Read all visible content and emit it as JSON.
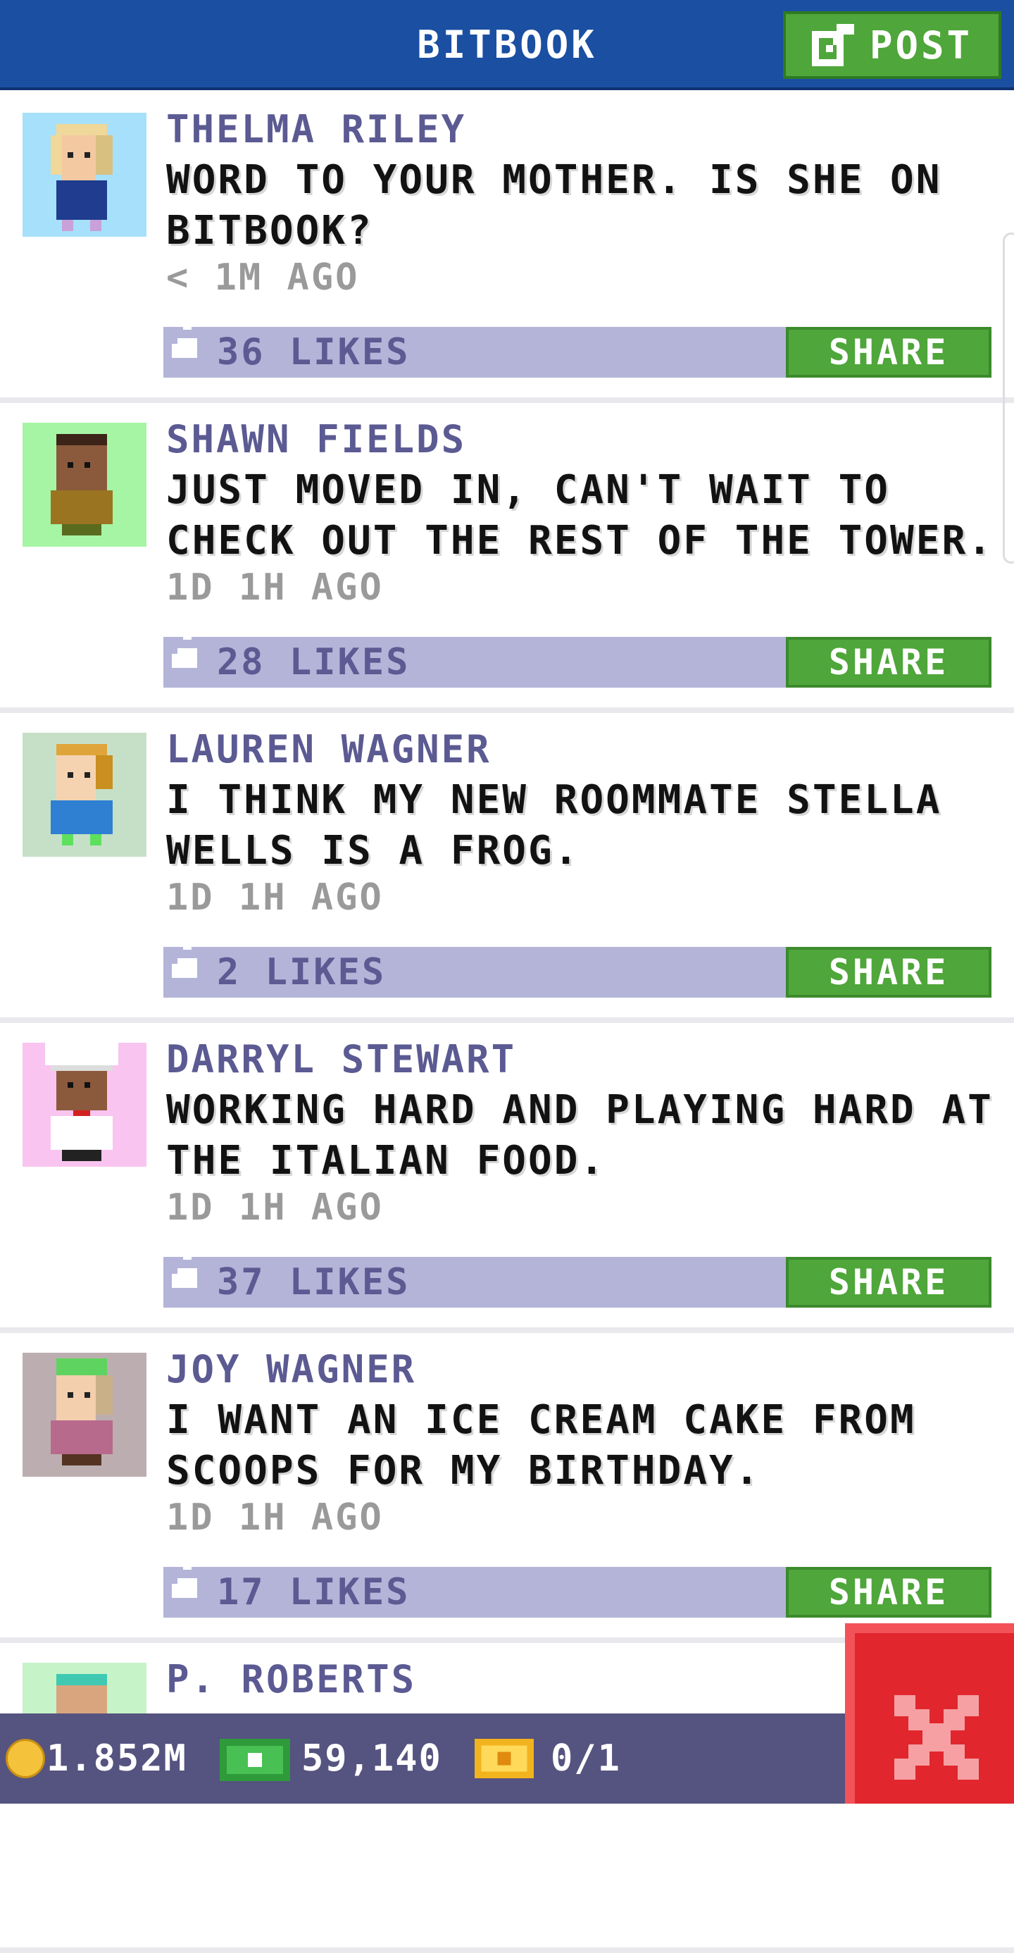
{
  "header": {
    "title": "BITBOOK",
    "post_label": "POST"
  },
  "posts": [
    {
      "name": "THELMA RILEY",
      "message": "WORD TO YOUR MOTHER. IS SHE ON BITBOOK?",
      "time": "< 1M AGO",
      "likes": "36 LIKES",
      "share": "SHARE",
      "avatar_bg": "#a6e0fb"
    },
    {
      "name": "SHAWN FIELDS",
      "message": "JUST MOVED IN, CAN'T WAIT TO CHECK OUT THE REST OF THE TOWER.",
      "time": "1D 1H AGO",
      "likes": "28 LIKES",
      "share": "SHARE",
      "avatar_bg": "#a5f5a5"
    },
    {
      "name": "LAUREN WAGNER",
      "message": "I THINK MY NEW ROOMMATE STELLA WELLS IS A FROG.",
      "time": "1D 1H AGO",
      "likes": "2 LIKES",
      "share": "SHARE",
      "avatar_bg": "#c6e0c8"
    },
    {
      "name": "DARRYL STEWART",
      "message": "WORKING HARD AND PLAYING HARD AT THE ITALIAN FOOD.",
      "time": "1D 1H AGO",
      "likes": "37 LIKES",
      "share": "SHARE",
      "avatar_bg": "#f9c4ef"
    },
    {
      "name": "JOY WAGNER",
      "message": "I WANT AN ICE CREAM CAKE FROM SCOOPS FOR MY BIRTHDAY.",
      "time": "1D 1H AGO",
      "likes": "17 LIKES",
      "share": "SHARE",
      "avatar_bg": "#bcaeb0"
    },
    {
      "name": "P. ROBERTS",
      "message": "",
      "time": "",
      "likes": "",
      "share": "",
      "avatar_bg": "#c6f3c8"
    }
  ],
  "status": {
    "coins": "1.852M",
    "bux": "59,140",
    "tickets": "0/1"
  },
  "colors": {
    "header_bg": "#1a4fa2",
    "accent_green": "#4fa63a",
    "like_bar": "#b3b4d8",
    "name_text": "#5b5a92",
    "close_red": "#e1262d"
  },
  "icons": [
    "compose-icon",
    "thumbs-up-icon",
    "coin-icon",
    "bux-icon",
    "ticket-icon",
    "close-icon"
  ]
}
